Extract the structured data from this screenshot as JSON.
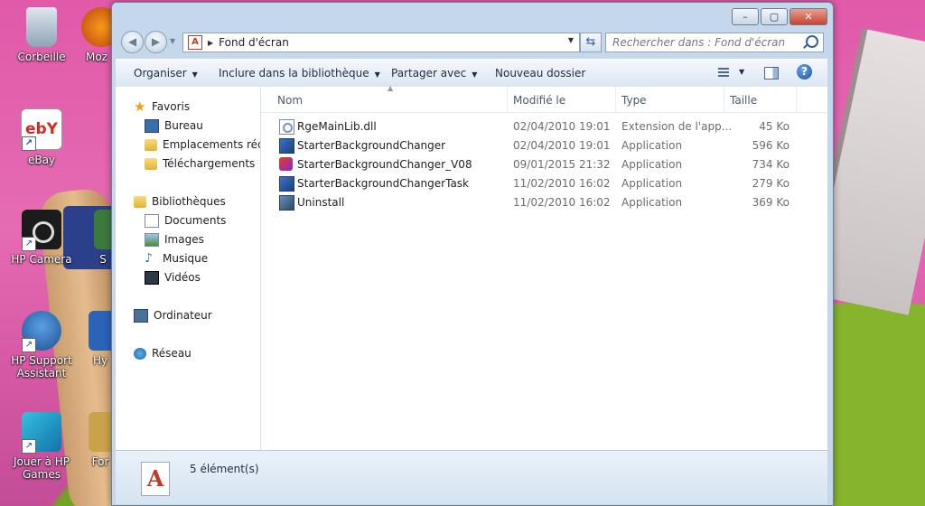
{
  "desktop": {
    "icons": [
      {
        "label": "Corbeille",
        "icon": "recycle-bin-icon"
      },
      {
        "label": "Moz",
        "icon": "firefox-icon"
      },
      {
        "label": "eBay",
        "icon": "ebay-icon"
      },
      {
        "label": "HP Camera",
        "icon": "camera-icon"
      },
      {
        "label": "S",
        "icon": "app-icon"
      },
      {
        "label": "HP Support Assistant",
        "icon": "support-icon"
      },
      {
        "label": "Hy",
        "icon": "app-icon"
      },
      {
        "label": "Jouer à HP Games",
        "icon": "games-icon"
      },
      {
        "label": "For",
        "icon": "app-icon"
      }
    ]
  },
  "window": {
    "controls": {
      "minimize": "–",
      "maximize": "▢",
      "close": "✕"
    },
    "address": {
      "path": "Fond d'écran"
    },
    "search": {
      "placeholder": "Rechercher dans : Fond d'écran"
    },
    "toolbar": {
      "organize": "Organiser",
      "include": "Inclure dans la bibliothèque",
      "share": "Partager avec",
      "new_folder": "Nouveau dossier"
    },
    "nav": {
      "favorites": "Favoris",
      "desktop": "Bureau",
      "recent": "Emplacements récents",
      "downloads": "Téléchargements",
      "libraries": "Bibliothèques",
      "documents": "Documents",
      "images": "Images",
      "music": "Musique",
      "videos": "Vidéos",
      "computer": "Ordinateur",
      "network": "Réseau"
    },
    "columns": {
      "name": "Nom",
      "modified": "Modifié le",
      "type": "Type",
      "size": "Taille"
    },
    "files": [
      {
        "name": "RgeMainLib.dll",
        "modified": "02/04/2010 19:01",
        "type": "Extension de l'app...",
        "size": "45 Ko",
        "icon": "dll-icon"
      },
      {
        "name": "StarterBackgroundChanger",
        "modified": "02/04/2010 19:01",
        "type": "Application",
        "size": "596 Ko",
        "icon": "application-icon"
      },
      {
        "name": "StarterBackgroundChanger_V08",
        "modified": "09/01/2015 21:32",
        "type": "Application",
        "size": "734 Ko",
        "icon": "installer-icon"
      },
      {
        "name": "StarterBackgroundChangerTask",
        "modified": "11/02/2010 16:02",
        "type": "Application",
        "size": "279 Ko",
        "icon": "application-icon"
      },
      {
        "name": "Uninstall",
        "modified": "11/02/2010 16:02",
        "type": "Application",
        "size": "369 Ko",
        "icon": "uninstall-icon"
      }
    ],
    "status": {
      "count": "5 élément(s)"
    }
  }
}
